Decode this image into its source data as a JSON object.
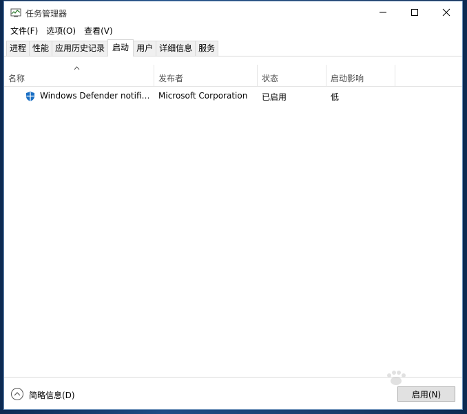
{
  "window": {
    "title": "任务管理器",
    "accent_color": "#6b8fb8"
  },
  "menu": {
    "items": [
      {
        "label": "文件(F)"
      },
      {
        "label": "选项(O)"
      },
      {
        "label": "查看(V)"
      }
    ]
  },
  "tabs": [
    {
      "label": "进程",
      "active": false
    },
    {
      "label": "性能",
      "active": false
    },
    {
      "label": "应用历史记录",
      "active": false
    },
    {
      "label": "启动",
      "active": true
    },
    {
      "label": "用户",
      "active": false
    },
    {
      "label": "详细信息",
      "active": false
    },
    {
      "label": "服务",
      "active": false
    }
  ],
  "table": {
    "columns": [
      "名称",
      "发布者",
      "状态",
      "启动影响"
    ],
    "sort_column": "名称",
    "rows": [
      {
        "icon": "windows-defender-shield-icon",
        "name": "Windows Defender notific...",
        "publisher": "Microsoft Corporation",
        "status": "已启用",
        "impact": "低"
      }
    ]
  },
  "footer": {
    "collapse_label": "简略信息(D)",
    "enable_button_label": "启用(N)"
  }
}
